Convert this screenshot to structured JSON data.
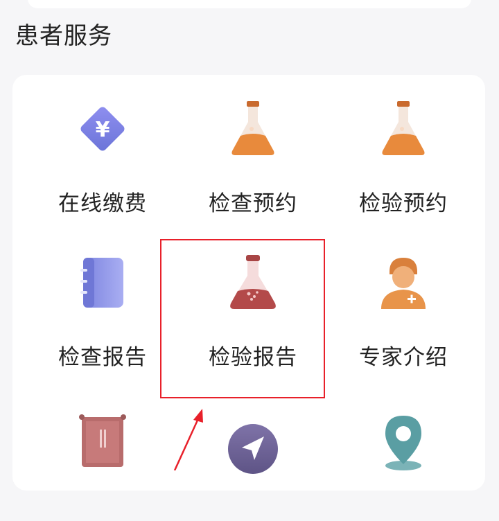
{
  "section": {
    "title": "患者服务"
  },
  "services": [
    {
      "label": "在线缴费",
      "icon": "yuan-diamond-icon"
    },
    {
      "label": "检查预约",
      "icon": "flask-icon"
    },
    {
      "label": "检验预约",
      "icon": "flask-icon"
    },
    {
      "label": "检查报告",
      "icon": "notebook-icon"
    },
    {
      "label": "检验报告",
      "icon": "flask-icon"
    },
    {
      "label": "专家介绍",
      "icon": "doctor-icon"
    },
    {
      "label": "",
      "icon": "box-icon"
    },
    {
      "label": "",
      "icon": "navigation-arrow-icon"
    },
    {
      "label": "",
      "icon": "location-pin-icon"
    }
  ],
  "colors": {
    "accent_red": "#e8202a",
    "flask_orange": "#e88a3c",
    "flask_red": "#b34a4a",
    "diamond_purple": "#7b7fe0",
    "notebook_blue": "#8c93e6",
    "doctor_orange": "#e8944a"
  }
}
